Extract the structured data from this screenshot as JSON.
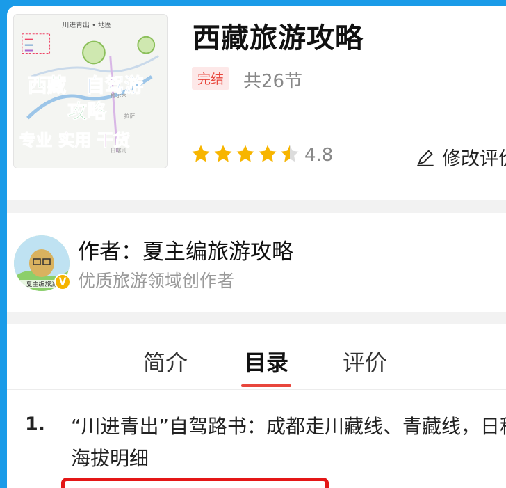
{
  "book": {
    "title": "西藏旅游攻略",
    "status_badge": "完结",
    "section_count": "共26节",
    "rating": "4.8",
    "rating_stars": 4.5,
    "edit_review_label": "修改评价"
  },
  "cover": {
    "top_label": "川进青出 • 地图",
    "main_line1": "西藏",
    "main_line1b": "自驾游",
    "main_line2": "攻略",
    "main_line3": "专业 实用 干货"
  },
  "author": {
    "name": "作者：夏主编旅游攻略",
    "description": "优质旅游领域创作者",
    "avatar_label": "夏主编旅游",
    "verified_mark": "V"
  },
  "tabs": [
    {
      "label": "简介"
    },
    {
      "label": "目录"
    },
    {
      "label": "评价"
    }
  ],
  "toc": [
    {
      "number": "1.",
      "title": "“川进青出”自驾路书：成都走川藏线、青藏线，日程、海拔明细"
    }
  ],
  "colors": {
    "accent": "#e8463c",
    "star": "#f7b500",
    "frame": "#1a9be8"
  }
}
